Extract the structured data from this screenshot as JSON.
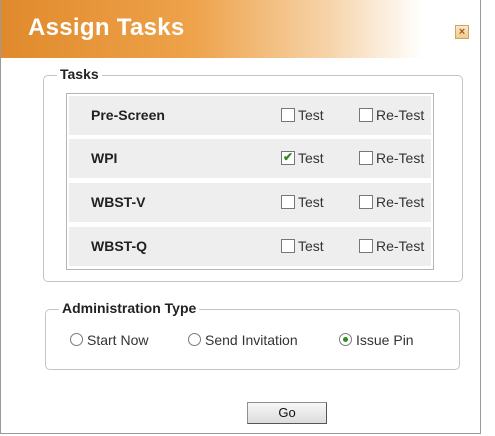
{
  "dialog": {
    "title": "Assign Tasks",
    "close_icon": "close-icon"
  },
  "tasks": {
    "legend": "Tasks",
    "option_test_label": "Test",
    "option_retest_label": "Re-Test",
    "rows": [
      {
        "label": "Pre-Screen",
        "test_checked": false,
        "retest_checked": false,
        "test": "Test",
        "retest": "Re-Test"
      },
      {
        "label": "WPI",
        "test_checked": true,
        "retest_checked": false,
        "test": "Test",
        "retest": "Re-Test"
      },
      {
        "label": "WBST-V",
        "test_checked": false,
        "retest_checked": false,
        "test": "Test",
        "retest": "Re-Test"
      },
      {
        "label": "WBST-Q",
        "test_checked": false,
        "retest_checked": false,
        "test": "Test",
        "retest": "Re-Test"
      }
    ]
  },
  "administration": {
    "legend": "Administration Type",
    "options": [
      {
        "label": "Start Now",
        "selected": false
      },
      {
        "label": "Send Invitation",
        "selected": false
      },
      {
        "label": "Issue Pin",
        "selected": true
      }
    ]
  },
  "actions": {
    "go_label": "Go"
  },
  "colors": {
    "header_accent": "#e08a2c",
    "check_green": "#2f8b1e"
  }
}
